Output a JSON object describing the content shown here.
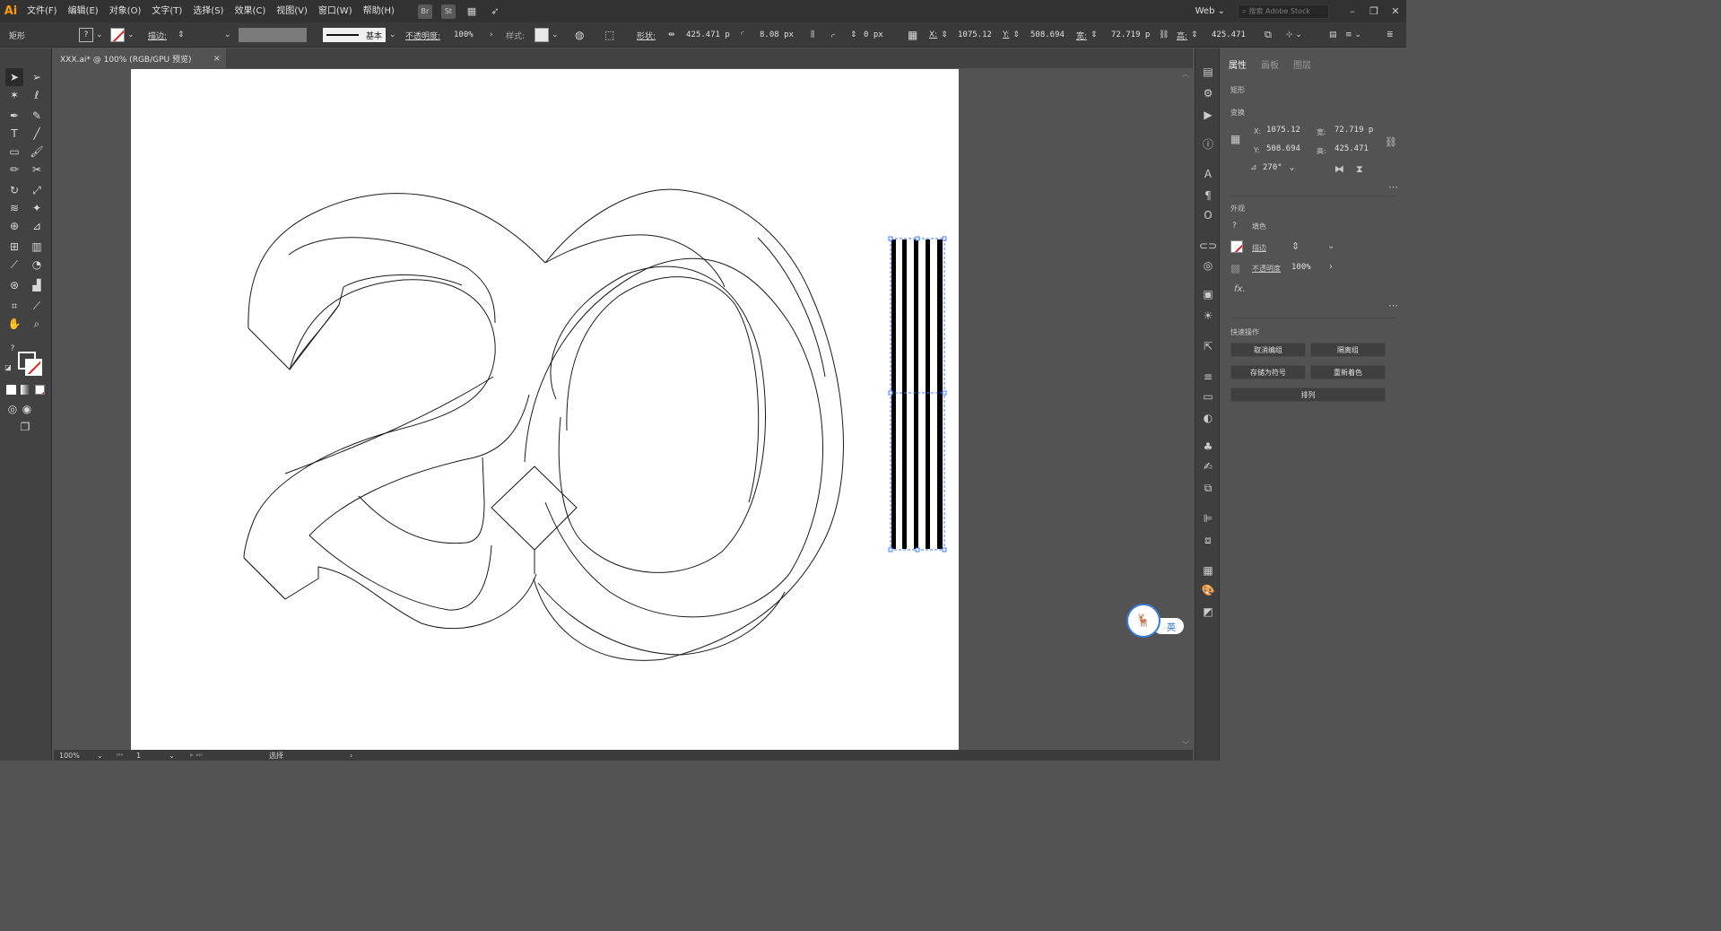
{
  "app": {
    "logo": "Ai"
  },
  "menu": {
    "items": [
      "文件(F)",
      "编辑(E)",
      "对象(O)",
      "文字(T)",
      "选择(S)",
      "效果(C)",
      "视图(V)",
      "窗口(W)",
      "帮助(H)"
    ],
    "bridge": "Br",
    "stock": "St",
    "workspace": "Web",
    "search_placeholder": "搜索 Adobe Stock"
  },
  "control": {
    "object_type": "矩形",
    "stroke_label": "描边:",
    "stroke_style": "基本",
    "opacity_label": "不透明度:",
    "opacity_value": "100%",
    "style_label": "样式:",
    "shape_label": "形状:",
    "shape_width": "425.471 p",
    "corner_radius": "8.08 px",
    "offset": "0 px",
    "x_label": "X:",
    "x_value": "1075.12 ",
    "y_label": "Y:",
    "y_value": "508.694 ",
    "w_label": "宽:",
    "w_value": "72.719 p",
    "h_label": "高:",
    "h_value": "425.471 "
  },
  "document": {
    "tab_title": "XXX.ai* @ 100% (RGB/GPU 预览)",
    "close": "×"
  },
  "status": {
    "zoom": "100%",
    "artboard": "1",
    "tool": "选择"
  },
  "panel": {
    "tabs": [
      "属性",
      "画板",
      "图层"
    ],
    "object_type": "矩形",
    "transform_title": "变换",
    "x_label": "X:",
    "x_value": "1075.12",
    "y_label": "Y:",
    "y_value": "508.694",
    "w_label": "宽:",
    "w_value": "72.719 p",
    "h_label": "高:",
    "h_value": "425.471",
    "angle": "270°",
    "appearance_title": "外观",
    "fill_label": "填色",
    "stroke_label": "描边",
    "opacity_label": "不透明度",
    "opacity_value": "100%",
    "fx": "fx.",
    "quick_title": "快速操作",
    "btn_ungroup": "取消编组",
    "btn_isolate": "隔离组",
    "btn_symbol": "存储为符号",
    "btn_recolor": "重新着色",
    "btn_arrange": "排列"
  },
  "ime": {
    "lang": "英"
  }
}
